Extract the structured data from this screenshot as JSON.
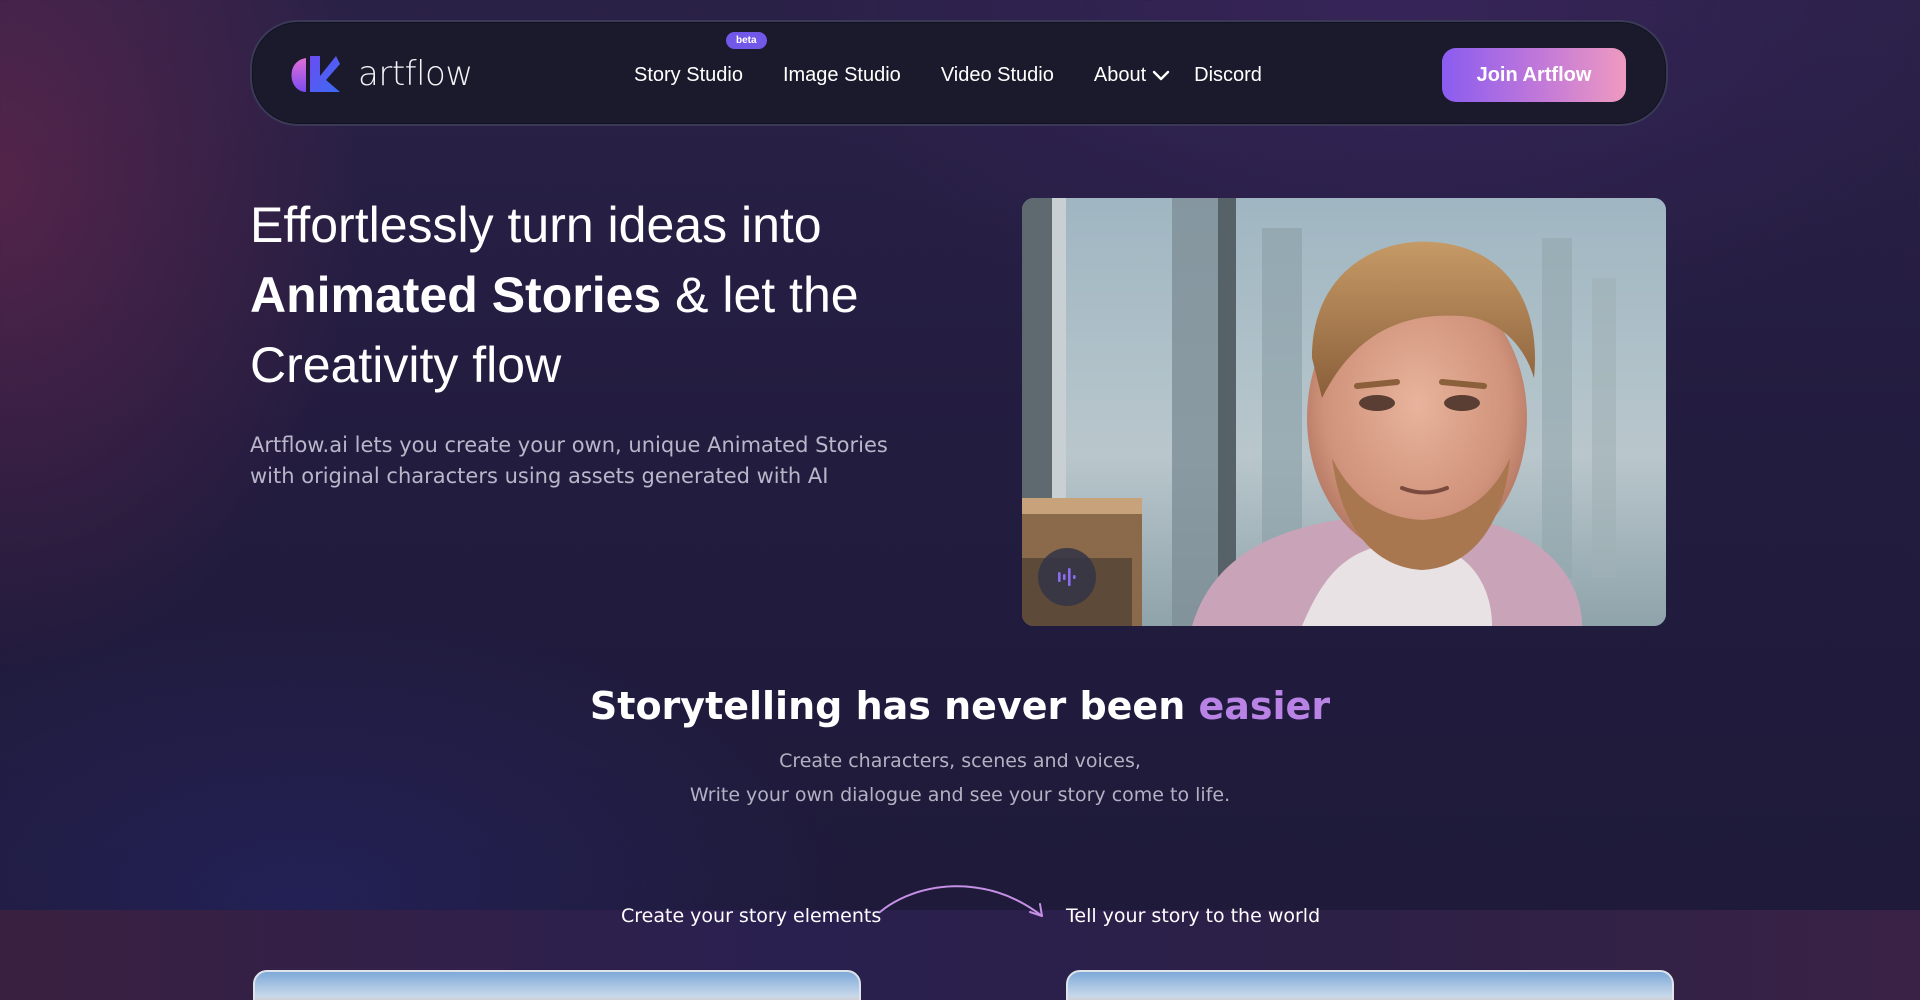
{
  "brand": {
    "name": "artflow"
  },
  "nav": {
    "items": [
      {
        "label": "Story Studio",
        "badge": "beta"
      },
      {
        "label": "Image Studio"
      },
      {
        "label": "Video Studio"
      },
      {
        "label": "About",
        "has_dropdown": true
      },
      {
        "label": "Discord"
      }
    ],
    "cta_label": "Join Artflow"
  },
  "hero": {
    "title_line1": "Effortlessly turn ideas into",
    "title_bold": "Animated Stories",
    "title_line2_rest": " & let the",
    "title_line3": "Creativity flow",
    "subtitle_line1": "Artflow.ai lets you create your own, unique Animated Stories",
    "subtitle_line2": "with original characters using assets generated with AI"
  },
  "section": {
    "heading_main": "Storytelling has never been ",
    "heading_accent": "easier",
    "line1": "Create characters, scenes and voices,",
    "line2": "Write your own dialogue and see your story come to life."
  },
  "steps": {
    "left_label": "Create your story elements",
    "right_label": "Tell your story to the world"
  },
  "colors": {
    "accent_purple": "#7258e8",
    "heading_accent": "#b983e6",
    "cta_gradient_start": "#8a5cf0",
    "cta_gradient_end": "#ef9ac0"
  },
  "icons": {
    "logo": "artflow-logo-icon",
    "dropdown": "chevron-down-icon",
    "audio": "audio-wave-icon",
    "arrow": "curved-arrow-icon"
  }
}
